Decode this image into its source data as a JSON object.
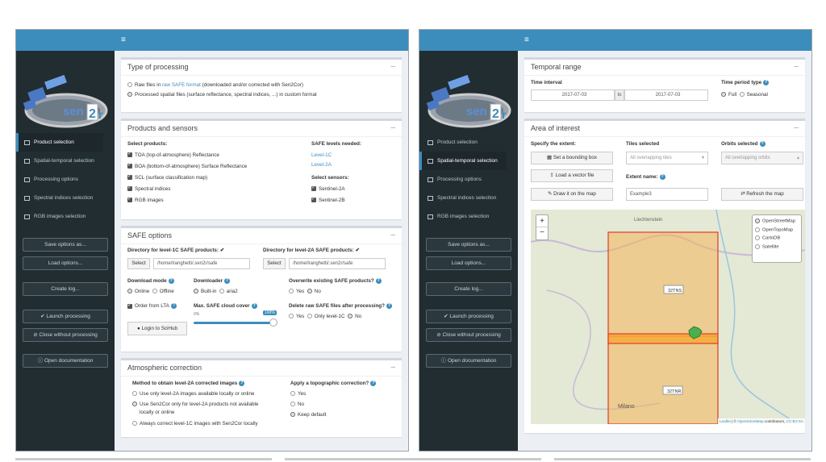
{
  "app": {
    "name": "sen2r",
    "menu_icon": "hamburger-icon"
  },
  "sidebar": {
    "items": [
      {
        "label": "Product selection",
        "icon": "file-icon"
      },
      {
        "label": "Spatial-temporal selection",
        "icon": "clone-icon"
      },
      {
        "label": "Processing options",
        "icon": "grid-icon"
      },
      {
        "label": "Spectral indices selection",
        "icon": "database-icon"
      },
      {
        "label": "RGB images selection",
        "icon": "palette-icon"
      }
    ],
    "save_options": "Save options as...",
    "load_options": "Load options...",
    "create_log": "Create log...",
    "launch": "Launch processing",
    "close": "Close without processing",
    "doc": "Open documentation"
  },
  "left": {
    "type_processing": {
      "title": "Type of processing",
      "opt1_a": "Raw files in ",
      "opt1_link": "raw SAFE format",
      "opt1_b": " (downloaded and/or corrected with Sen2Cor)",
      "opt2": "Processed spatial files (surface reflectance, spectral indices, ...) in custom format"
    },
    "products": {
      "title": "Products and sensors",
      "select_label": "Select products:",
      "items": [
        "TOA (top-of-atmosphere) Reflectance",
        "BOA (bottom-of-atmosphere) Surface Reflectance",
        "SCL (surface classification map)",
        "Spectral indices",
        "RGB images"
      ],
      "safe_levels_label": "SAFE levels needed:",
      "level1c": "Level-1C",
      "level2a": "Level-2A",
      "sensors_label": "Select sensors:",
      "s2a": "Sentinel-2A",
      "s2b": "Sentinel-2B"
    },
    "safe": {
      "title": "SAFE options",
      "dir1c_label": "Directory for level-1C SAFE products:",
      "dir2a_label": "Directory for level-2A SAFE products:",
      "select": "Select",
      "dir1c": "/home/lranghetti/.sen2r/safe",
      "dir2a": "/home/lranghetti/.sen2r/safe",
      "download_mode": "Download mode",
      "online": "Online",
      "offline": "Offline",
      "downloader": "Downloader",
      "builtin": "Built-in",
      "aria2": "aria2",
      "overwrite": "Overwrite existing SAFE products?",
      "yes": "Yes",
      "no": "No",
      "order_lta": "Order from LTA",
      "max_cloud": "Max. SAFE cloud cover",
      "cloud_min": "0%",
      "cloud_max": "100%",
      "cloud_value": 1.0,
      "login": "Login to SciHub",
      "delete_raw": "Delete raw SAFE files after processing?",
      "only1c": "Only level-1C"
    },
    "atm": {
      "title": "Atmospheric correction",
      "method_label": "Method to obtain level-2A corrected images",
      "m1": "Use only level-2A images available locally or online",
      "m2a": "Use Sen2Cor only for level-2A products not available",
      "m2b": "locally or online",
      "m3": "Always correct level-1C images with Sen2Cor locally",
      "topo_label": "Apply a topographic correction?",
      "yes": "Yes",
      "no": "No",
      "keep": "Keep default"
    }
  },
  "right": {
    "temporal": {
      "title": "Temporal range",
      "interval_label": "Time interval",
      "from": "2017-07-03",
      "to_word": "to",
      "to": "2017-07-03",
      "period_label": "Time period type",
      "full": "Full",
      "seasonal": "Seasonal"
    },
    "aoi": {
      "title": "Area of interest",
      "specify": "Specify the extent:",
      "bbox": "Set a bounding box",
      "vector": "Load a vector file",
      "draw": "Draw it on the map",
      "tiles_label": "Tiles selected",
      "tiles_ph": "All overlapping tiles",
      "orbits_label": "Orbits selected",
      "orbits_ph": "All overlapping orbits",
      "extent_label": "Extent name:",
      "extent_value": "Example3",
      "refresh": "Refresh the map",
      "tile1": "32TNS",
      "tile2": "32TNR",
      "place": "Liechtenstein",
      "city": "Milano",
      "layers": [
        "OpenStreetMap",
        "OpenTopoMap",
        "CartoDB",
        "Satellite"
      ],
      "zoom_in": "+",
      "zoom_out": "−",
      "attr_leaflet": "Leaflet",
      "attr_sep": " | © ",
      "attr_osm": "OpenStreetMap",
      "attr_rest": " contributors, ",
      "attr_cc": "CC-BY-SA"
    }
  }
}
